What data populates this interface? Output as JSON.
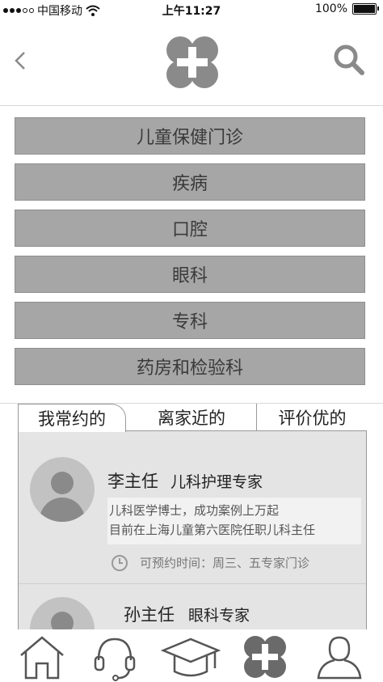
{
  "status_bar": {
    "carrier": "中国移动",
    "time": "上午11:27",
    "battery": "100%"
  },
  "nav": {
    "back_icon": "chevron-left-icon",
    "logo_icon": "medical-cross-logo-icon",
    "search_icon": "search-icon"
  },
  "menu": {
    "items": [
      "儿童保健门诊",
      "疾病",
      "口腔",
      "眼科",
      "专科",
      "药房和检验科"
    ]
  },
  "tabs": [
    "我常约的",
    "离家近的",
    "评价优的"
  ],
  "doctors": [
    {
      "name": "李主任",
      "title": "儿科护理专家",
      "bio_line1": "儿科医学博士，成功案例上万起",
      "bio_line2": "目前在上海儿童第六医院任职儿科主任",
      "schedule": "可预约时间：周三、五专家门诊"
    },
    {
      "name": "孙主任",
      "title": "眼科专家"
    }
  ],
  "bottom_nav": [
    "home-icon",
    "headset-icon",
    "graduation-cap-icon",
    "medical-cross-icon",
    "user-icon"
  ],
  "colors": {
    "button_fill": "#a6a6a6",
    "panel_fill": "#e4e4e4",
    "icon_gray": "#8a8a8a"
  }
}
